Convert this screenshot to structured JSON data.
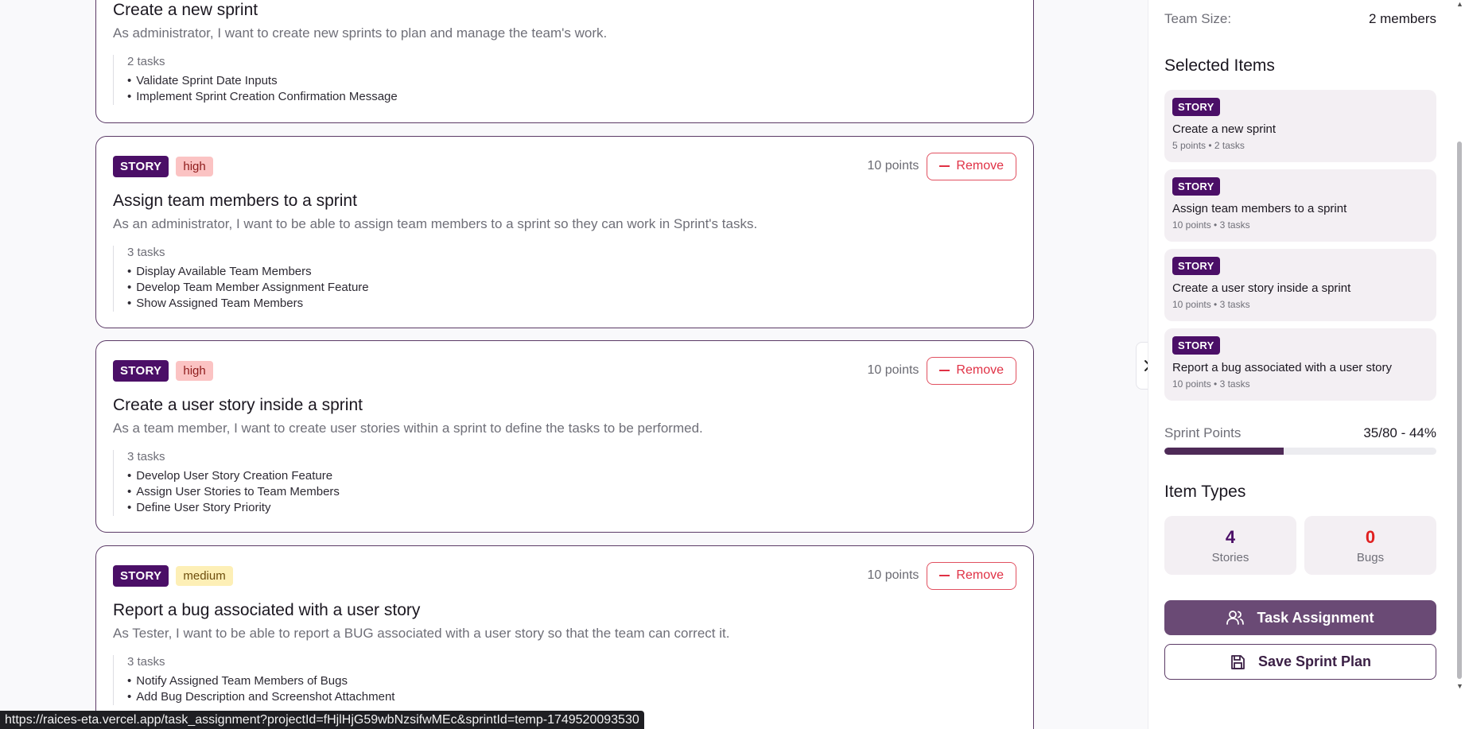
{
  "cards": [
    {
      "title": "Create a new sprint",
      "description": "As administrator, I want to create new sprints to plan and manage the team's work.",
      "tasks_count": "2 tasks",
      "tasks": [
        "Validate Sprint Date Inputs",
        "Implement Sprint Creation Confirmation Message"
      ]
    },
    {
      "type": "STORY",
      "priority": "high",
      "points": "10 points",
      "remove_label": "Remove",
      "title": "Assign team members to a sprint",
      "description": "As an administrator, I want to be able to assign team members to a sprint so they can work in Sprint's tasks.",
      "tasks_count": "3 tasks",
      "tasks": [
        "Display Available Team Members",
        "Develop Team Member Assignment Feature",
        "Show Assigned Team Members"
      ]
    },
    {
      "type": "STORY",
      "priority": "high",
      "points": "10 points",
      "remove_label": "Remove",
      "title": "Create a user story inside a sprint",
      "description": "As a team member, I want to create user stories within a sprint to define the tasks to be performed.",
      "tasks_count": "3 tasks",
      "tasks": [
        "Develop User Story Creation Feature",
        "Assign User Stories to Team Members",
        "Define User Story Priority"
      ]
    },
    {
      "type": "STORY",
      "priority": "medium",
      "points": "10 points",
      "remove_label": "Remove",
      "title": "Report a bug associated with a user story",
      "description": "As Tester, I want to be able to report a BUG associated with a user story so that the team can correct it.",
      "tasks_count": "3 tasks",
      "tasks": [
        "Notify Assigned Team Members of Bugs",
        "Add Bug Description and Screenshot Attachment"
      ]
    }
  ],
  "sidebar": {
    "team_size_label": "Team Size:",
    "team_size_value": "2 members",
    "selected_title": "Selected Items",
    "selected_items": [
      {
        "type": "STORY",
        "title": "Create a new sprint",
        "meta": "5 points • 2 tasks"
      },
      {
        "type": "STORY",
        "title": "Assign team members to a sprint",
        "meta": "10 points • 3 tasks"
      },
      {
        "type": "STORY",
        "title": "Create a user story inside a sprint",
        "meta": "10 points • 3 tasks"
      },
      {
        "type": "STORY",
        "title": "Report a bug associated with a user story",
        "meta": "10 points • 3 tasks"
      }
    ],
    "sprint_points_label": "Sprint Points",
    "sprint_points_value": "35/80 - 44%",
    "sprint_points_fraction": 0.44,
    "item_types_title": "Item Types",
    "stories_count": "4",
    "stories_label": "Stories",
    "bugs_count": "0",
    "bugs_label": "Bugs",
    "task_assignment_label": "Task Assignment",
    "save_plan_label": "Save Sprint Plan"
  },
  "status_url": "https://raices-eta.vercel.app/task_assignment?projectId=fHjlHjG59wbNzsifwMEc&sprintId=temp-1749520093530",
  "colors": {
    "accent": "#4b0f67",
    "primary_button": "#6a4a75",
    "danger": "#e03145",
    "stories_count": "#4b0f67",
    "bugs_count": "#e02020"
  },
  "icons": {
    "remove": "minus-icon",
    "collapse": "chevron-right-icon",
    "task_assignment": "users-icon",
    "save": "save-icon"
  }
}
